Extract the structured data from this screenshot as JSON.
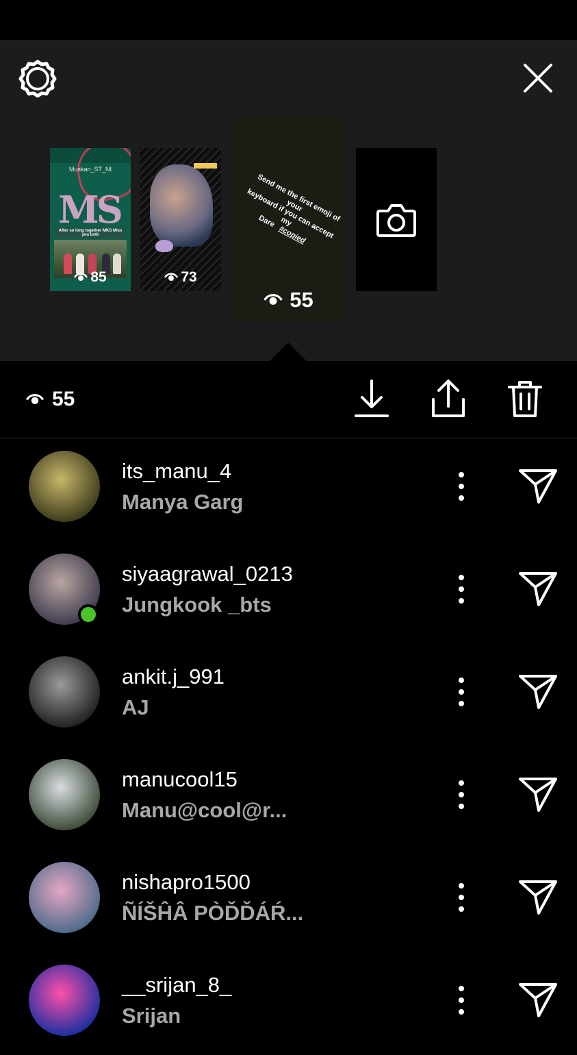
{
  "stories": [
    {
      "views": "85",
      "screenshot": {
        "chat_name": "Muskan_ST_NI",
        "caption": "After so long together MKS Miss you both",
        "monogram": "MS"
      }
    },
    {
      "views": "73"
    },
    {
      "views": "55",
      "text_lines": [
        "Send me the first emoji of your",
        "keyboard if you can accept my",
        "Dare"
      ],
      "tag": "#copied"
    }
  ],
  "toolbar": {
    "views": "55"
  },
  "viewers": [
    {
      "username": "its_manu_4",
      "name": "Manya Garg",
      "online": false,
      "avatar_colors": [
        "#c8b76a",
        "#3b3a1a"
      ]
    },
    {
      "username": "siyaagrawal_0213",
      "name": "Jungkook _bts",
      "online": true,
      "avatar_colors": [
        "#b9a6a2",
        "#3f3b4d"
      ]
    },
    {
      "username": "ankit.j_991",
      "name": "AJ",
      "online": false,
      "avatar_colors": [
        "#9a9a9a",
        "#202020"
      ]
    },
    {
      "username": "manucool15",
      "name": "Manu@cool@r...",
      "online": false,
      "avatar_colors": [
        "#d8dde2",
        "#3d4a37"
      ]
    },
    {
      "username": "nishapro1500",
      "name": "ÑÍŠĤÂ PÒĎĎÁŔ...",
      "online": false,
      "avatar_colors": [
        "#e5a7c4",
        "#4d6a8a"
      ]
    },
    {
      "username": "__srijan_8_",
      "name": "Srijan",
      "online": false,
      "avatar_colors": [
        "#ff4fa8",
        "#1a2fa0"
      ]
    }
  ],
  "colors": {
    "panel": "#1c1c1c",
    "online": "#4bc42b",
    "subtext": "#a8a8a8"
  },
  "icons": [
    "settings-icon",
    "close-icon",
    "eye-icon",
    "camera-icon",
    "download-icon",
    "share-icon",
    "trash-icon",
    "more-icon",
    "send-icon"
  ]
}
